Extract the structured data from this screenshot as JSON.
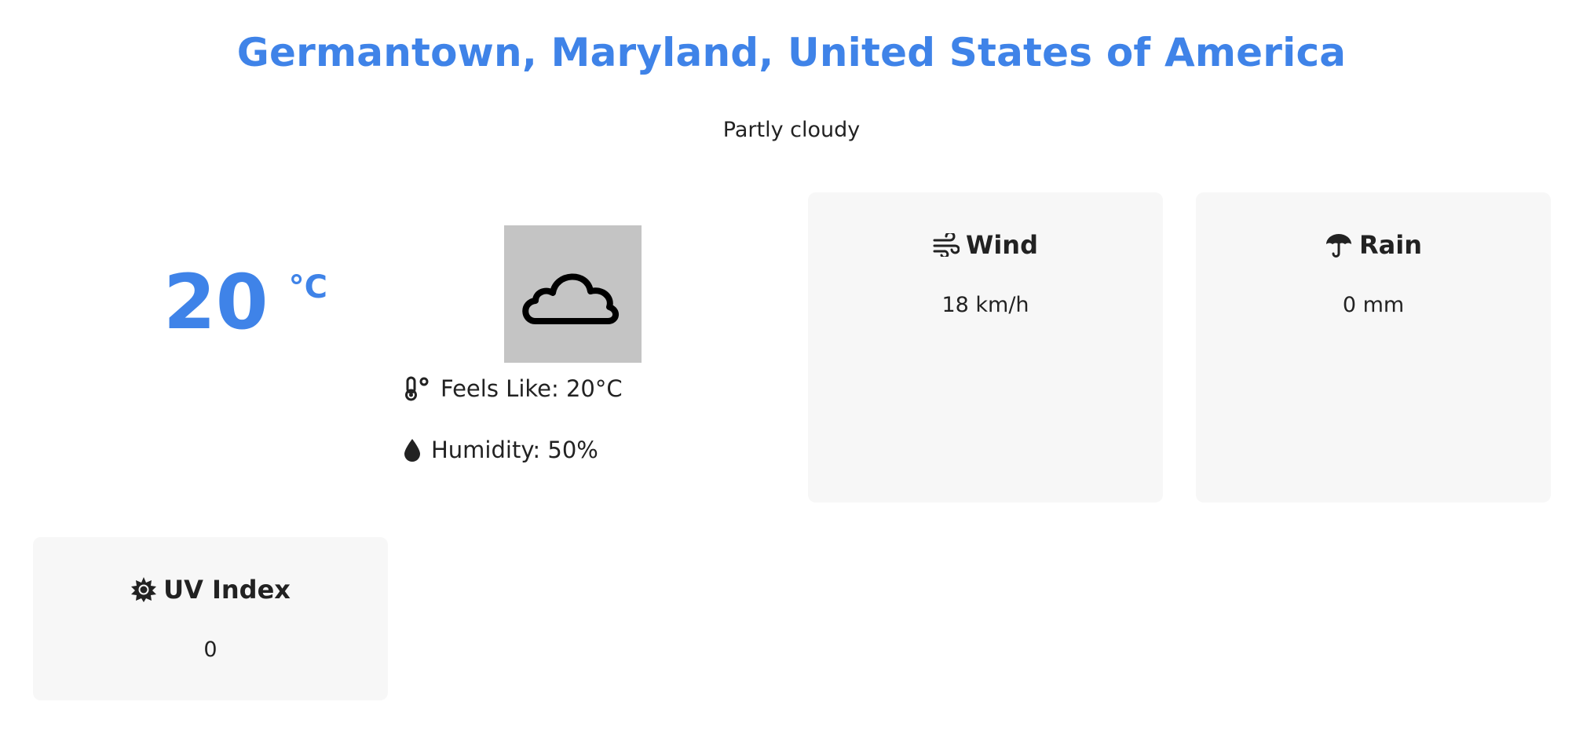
{
  "location": "Germantown, Maryland, United States of America",
  "condition": "Partly cloudy",
  "temperature": {
    "value": "20",
    "unit": "°C"
  },
  "weather_icon": "cloud-icon",
  "details": {
    "feels_like": "Feels Like: 20°C",
    "humidity": "Humidity: 50%"
  },
  "cards": {
    "wind": {
      "title": "Wind",
      "value": "18 km/h",
      "icon": "wind-icon"
    },
    "rain": {
      "title": "Rain",
      "value": "0 mm",
      "icon": "umbrella-icon"
    },
    "uv": {
      "title": "UV Index",
      "value": "0",
      "icon": "sun-icon"
    }
  },
  "colors": {
    "accent": "#3f83e8",
    "card_bg": "#f7f7f7",
    "icon_bg": "#c4c4c4",
    "text": "#222222"
  }
}
